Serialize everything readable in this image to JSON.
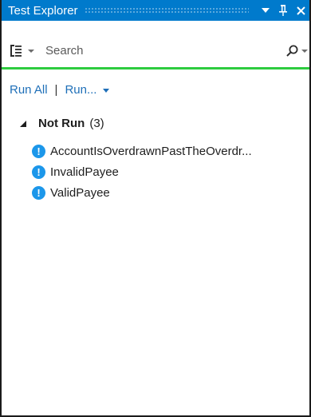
{
  "window": {
    "title": "Test Explorer",
    "colors": {
      "titlebar": "#007acc",
      "progress": "#2ecc40",
      "link": "#1e6fb8",
      "status_icon": "#1c97ea"
    },
    "icons": [
      "dropdown-arrow-icon",
      "pin-icon",
      "close-icon"
    ]
  },
  "toolbar": {
    "group_by_icon": "group-by-icon",
    "search": {
      "placeholder": "Search",
      "value": ""
    },
    "search_icon": "search-icon"
  },
  "actions": {
    "run_all": "Run All",
    "separator": "|",
    "run": "Run..."
  },
  "tree": {
    "group": {
      "name": "Not Run",
      "count": "(3)",
      "expanded": true
    },
    "status_glyph": "!",
    "items": [
      {
        "label": "AccountIsOverdrawnPastTheOverdr..."
      },
      {
        "label": "InvalidPayee"
      },
      {
        "label": "ValidPayee"
      }
    ]
  }
}
